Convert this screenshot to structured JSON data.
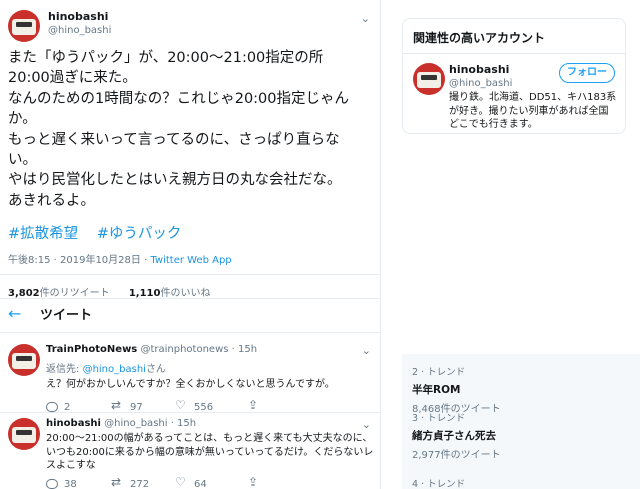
{
  "tweet": {
    "name": "hinobashi",
    "handle": "@hino_bashi",
    "text": "また「ゆうパック」が、20:00〜21:00指定の所\n20:00過ぎに来た。\nなんのための1時間なの？これじゃ20:00指定じゃん\nか。\nもっと遅く来いって言ってるのに、さっぱり直らな\nい。\nやはり民営化したとはいえ親方日の丸な会社だな。\nあきれるよ。",
    "hashtags": [
      "#拡散希望",
      "#ゆうパック"
    ],
    "time": "午後8:15 · 2019年10月28日 · ",
    "via": "Twitter Web App",
    "retweets": "3,802",
    "retweets_label": "件のリツイート",
    "likes": "1,110",
    "likes_label": "件のいいね"
  },
  "tab": {
    "title": "ツイート"
  },
  "replies": [
    {
      "name": "TrainPhotoNews",
      "handle": "@trainphotonews",
      "time": "· 15h",
      "reply_to_prefix": "返信先: ",
      "reply_to": "@hino_bashi",
      "reply_to_suffix": "さん",
      "text": "え？何がおかしいんですか？全くおかしくないと思うんですが。",
      "reply_count": "2",
      "retweet_count": "97",
      "like_count": "556"
    },
    {
      "name": "hinobashi",
      "handle": "@hino_bashi",
      "time": "· 15h",
      "text": "20:00〜21:00の幅があるってことは、もっと遅く来ても大丈夫なのに、いつも20:00に来るから幅の意味が無いっていってるだけ。くだらないレスよこすな",
      "reply_count": "38",
      "retweet_count": "272",
      "like_count": "64"
    }
  ],
  "sidebar": {
    "related_title": "関連性の高いアカウント",
    "account": {
      "name": "hinobashi",
      "handle": "@hino_bashi",
      "follow_label": "フォロー",
      "bio": "撮り鉄。北海道、DD51、キハ183系が好き。撮りたい列車があれば全国どこでも行きます。"
    },
    "trends": [
      {
        "meta": "2 · トレンド",
        "name": "半年ROM",
        "count": "8,468件のツイート"
      },
      {
        "meta": "3 · トレンド",
        "name": "緒方貞子さん死去",
        "count": "2,977件のツイート"
      },
      {
        "meta": "4 · トレンド",
        "name": "",
        "count": ""
      }
    ]
  },
  "colors": {
    "accent": "#1da1f2",
    "link": "#1b95e0",
    "muted": "#657786",
    "text": "#14171a"
  }
}
